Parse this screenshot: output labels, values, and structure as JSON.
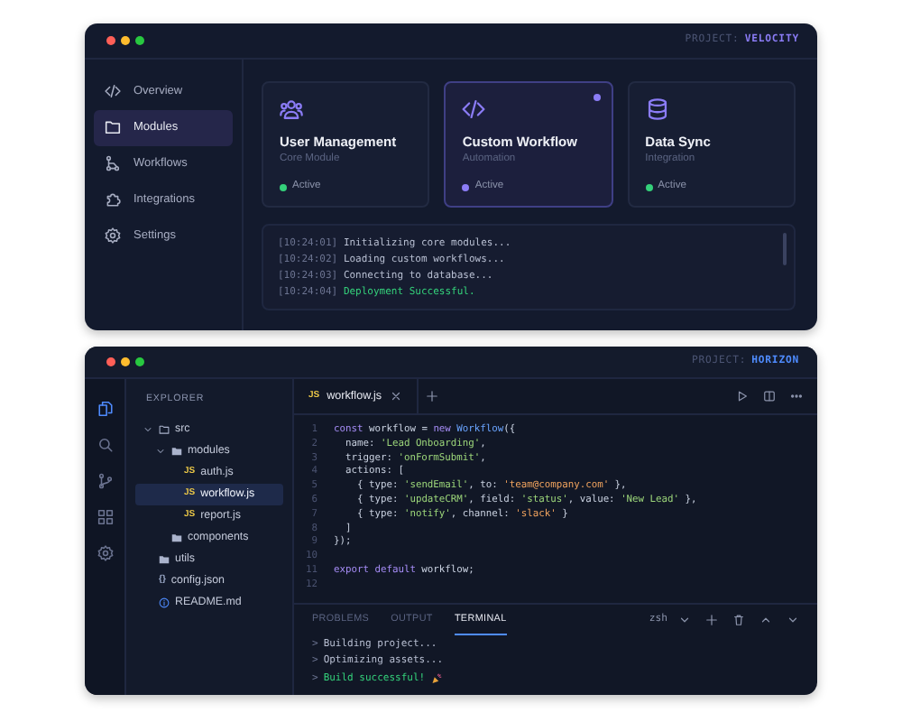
{
  "dashboard": {
    "project": {
      "label": "PROJECT:",
      "name": "VELOCITY"
    },
    "sidebar": [
      {
        "label": "Overview",
        "selected": false
      },
      {
        "label": "Modules",
        "selected": true
      },
      {
        "label": "Workflows",
        "selected": false
      },
      {
        "label": "Integrations",
        "selected": false
      },
      {
        "label": "Settings",
        "selected": false
      }
    ],
    "modules": [
      {
        "title": "User Management",
        "subtitle": "Core Module",
        "status": "Active",
        "color": "#34d07a",
        "selected": false
      },
      {
        "title": "Custom Workflow",
        "subtitle": "Automation",
        "status": "Active",
        "color": "#8b7cf6",
        "selected": true
      },
      {
        "title": "Data Sync",
        "subtitle": "Integration",
        "status": "Active",
        "color": "#34d07a",
        "selected": false
      }
    ],
    "log": [
      {
        "time": "[10:24:01]",
        "message": "Initializing core modules...",
        "kind": "info"
      },
      {
        "time": "[10:24:02]",
        "message": "Loading custom workflows...",
        "kind": "info"
      },
      {
        "time": "[10:24:03]",
        "message": "Connecting to database...",
        "kind": "info"
      },
      {
        "time": "[10:24:04]",
        "message": "Deployment Successful.",
        "kind": "success"
      }
    ]
  },
  "editor": {
    "project": {
      "label": "PROJECT:",
      "name": "HORIZON"
    },
    "activity_bar": [
      {
        "selected": true
      },
      {
        "selected": false
      },
      {
        "selected": false
      },
      {
        "selected": false
      },
      {
        "selected": false
      }
    ],
    "explorer": {
      "title": "EXPLORER",
      "tree": [
        {
          "label": "src",
          "kind": "folder",
          "expanded": true,
          "selected": false,
          "children": [
            {
              "label": "modules",
              "kind": "folder",
              "expanded": true,
              "selected": false,
              "children": [
                {
                  "label": "auth.js",
                  "kind": "script",
                  "badge": "JS",
                  "selected": false
                },
                {
                  "label": "workflow.js",
                  "kind": "script",
                  "badge": "JS",
                  "selected": true
                },
                {
                  "label": "report.js",
                  "kind": "script",
                  "badge": "JS",
                  "selected": false
                }
              ]
            },
            {
              "label": "components",
              "kind": "folder",
              "selected": false
            }
          ]
        },
        {
          "label": "utils",
          "kind": "folder",
          "selected": false
        },
        {
          "label": "config.json",
          "kind": "data",
          "badge": "{}",
          "selected": false
        },
        {
          "label": "README.md",
          "kind": "doc",
          "selected": false
        }
      ]
    },
    "tabs": [
      {
        "badge": "JS",
        "label": "workflow.js",
        "selected": true
      }
    ],
    "code": [
      {
        "number": "1",
        "tokens": [
          {
            "kind": "kw",
            "text": "const"
          },
          {
            "kind": "plain",
            "text": " workflow = "
          },
          {
            "kind": "kw",
            "text": "new"
          },
          {
            "kind": "fn",
            "text": " Workflow"
          },
          {
            "kind": "plain",
            "text": "({"
          }
        ]
      },
      {
        "number": "2",
        "tokens": [
          {
            "kind": "plain",
            "text": "  name: "
          },
          {
            "kind": "str",
            "text": "'Lead Onboarding'"
          },
          {
            "kind": "plain",
            "text": ","
          }
        ]
      },
      {
        "number": "3",
        "tokens": [
          {
            "kind": "plain",
            "text": "  trigger: "
          },
          {
            "kind": "str",
            "text": "'onFormSubmit'"
          },
          {
            "kind": "plain",
            "text": ","
          }
        ]
      },
      {
        "number": "4",
        "tokens": [
          {
            "kind": "plain",
            "text": "  actions: ["
          }
        ]
      },
      {
        "number": "5",
        "tokens": [
          {
            "kind": "plain",
            "text": "    { type: "
          },
          {
            "kind": "str",
            "text": "'sendEmail'"
          },
          {
            "kind": "plain",
            "text": ", to: "
          },
          {
            "kind": "str2",
            "text": "'team@company.com'"
          },
          {
            "kind": "plain",
            "text": " },"
          }
        ]
      },
      {
        "number": "6",
        "tokens": [
          {
            "kind": "plain",
            "text": "    { type: "
          },
          {
            "kind": "str",
            "text": "'updateCRM'"
          },
          {
            "kind": "plain",
            "text": ", field: "
          },
          {
            "kind": "str",
            "text": "'status'"
          },
          {
            "kind": "plain",
            "text": ", value: "
          },
          {
            "kind": "str",
            "text": "'New Lead'"
          },
          {
            "kind": "plain",
            "text": " },"
          }
        ]
      },
      {
        "number": "7",
        "tokens": [
          {
            "kind": "plain",
            "text": "    { type: "
          },
          {
            "kind": "str",
            "text": "'notify'"
          },
          {
            "kind": "plain",
            "text": ", channel: "
          },
          {
            "kind": "str2",
            "text": "'slack'"
          },
          {
            "kind": "plain",
            "text": " }"
          }
        ]
      },
      {
        "number": "8",
        "tokens": [
          {
            "kind": "plain",
            "text": "  ]"
          }
        ]
      },
      {
        "number": "9",
        "tokens": [
          {
            "kind": "plain",
            "text": "});"
          }
        ]
      },
      {
        "number": "10"
      },
      {
        "number": "11",
        "tokens": [
          {
            "kind": "kw",
            "text": "export default"
          },
          {
            "kind": "plain",
            "text": " workflow;"
          }
        ]
      },
      {
        "number": "12"
      }
    ],
    "panel": {
      "tabs": [
        {
          "label": "PROBLEMS",
          "selected": false
        },
        {
          "label": "OUTPUT",
          "selected": false
        },
        {
          "label": "TERMINAL",
          "selected": true
        }
      ],
      "shell": "zsh",
      "terminal": [
        {
          "prompt": ">",
          "text": "Building project...",
          "kind": "info"
        },
        {
          "prompt": ">",
          "text": "Optimizing assets...",
          "kind": "info"
        },
        {
          "prompt": ">",
          "text": "Build successful!",
          "kind": "success"
        }
      ]
    }
  }
}
